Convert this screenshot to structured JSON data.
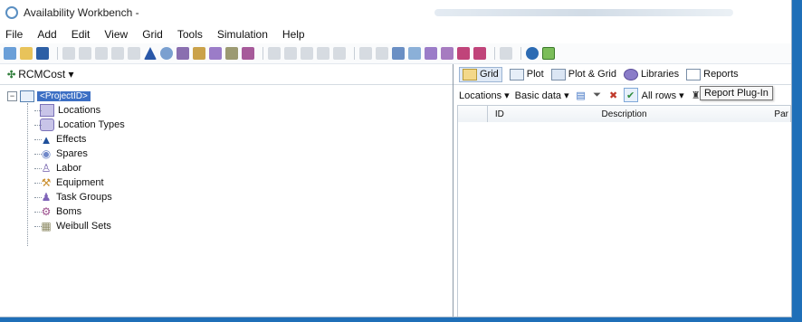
{
  "window": {
    "title": "Availability Workbench -"
  },
  "menu": {
    "items": [
      "File",
      "Add",
      "Edit",
      "View",
      "Grid",
      "Tools",
      "Simulation",
      "Help"
    ]
  },
  "left_pane": {
    "project_selector": "RCMCost ▾",
    "tree": {
      "root": "<ProjectID>",
      "children": [
        {
          "label": "Locations",
          "icon": "folder-icon"
        },
        {
          "label": "Location Types",
          "icon": "location-type-icon"
        },
        {
          "label": "Effects",
          "icon": "warning-triangle-icon"
        },
        {
          "label": "Spares",
          "icon": "spare-part-icon"
        },
        {
          "label": "Labor",
          "icon": "person-icon"
        },
        {
          "label": "Equipment",
          "icon": "equipment-icon"
        },
        {
          "label": "Task Groups",
          "icon": "task-group-icon"
        },
        {
          "label": "Boms",
          "icon": "bom-icon"
        },
        {
          "label": "Weibull Sets",
          "icon": "weibull-icon"
        }
      ]
    }
  },
  "right_pane": {
    "tabs": [
      "Grid",
      "Plot",
      "Plot & Grid",
      "Libraries",
      "Reports"
    ],
    "active_tab": "Grid",
    "tooltip": "Report Plug-In",
    "subtoolbar": {
      "locations_dropdown": "Locations ▾",
      "basic_data_dropdown": "Basic data ▾",
      "allrows_dropdown": "All rows ▾"
    },
    "grid": {
      "columns": [
        "ID",
        "Description",
        "Par"
      ]
    }
  }
}
